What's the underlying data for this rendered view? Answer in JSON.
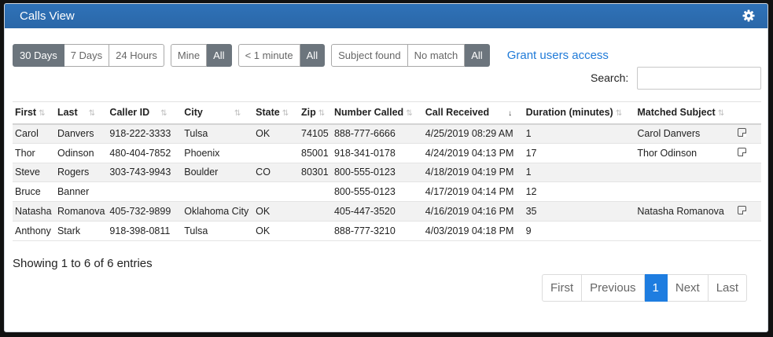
{
  "window": {
    "title": "Calls View"
  },
  "filters": {
    "time": [
      "30 Days",
      "7 Days",
      "24 Hours"
    ],
    "owner": [
      "Mine",
      "All"
    ],
    "duration": [
      "< 1 minute",
      "All"
    ],
    "match": [
      "Subject found",
      "No match",
      "All"
    ],
    "grant_link": "Grant users access"
  },
  "search": {
    "label": "Search:",
    "value": ""
  },
  "table": {
    "headers": [
      "First",
      "Last",
      "Caller ID",
      "City",
      "State",
      "Zip",
      "Number Called",
      "Call Received",
      "Duration (minutes)",
      "Matched Subject",
      ""
    ],
    "rows": [
      [
        "Carol",
        "Danvers",
        "918-222-3333",
        "Tulsa",
        "OK",
        "74105",
        "888-777-6666",
        "4/25/2019 08:29 AM",
        "1",
        "Carol Danvers"
      ],
      [
        "Thor",
        "Odinson",
        "480-404-7852",
        "Phoenix",
        "",
        "85001",
        "918-341-0178",
        "4/24/2019 04:13 PM",
        "17",
        "Thor Odinson"
      ],
      [
        "Steve",
        "Rogers",
        "303-743-9943",
        "Boulder",
        "CO",
        "80301",
        "800-555-0123",
        "4/18/2019 04:19 PM",
        "1",
        ""
      ],
      [
        "Bruce",
        "Banner",
        "",
        "",
        "",
        "",
        "800-555-0123",
        "4/17/2019 04:14 PM",
        "12",
        ""
      ],
      [
        "Natasha",
        "Romanova",
        "405-732-9899",
        "Oklahoma City",
        "OK",
        "",
        "405-447-3520",
        "4/16/2019 04:16 PM",
        "35",
        "Natasha Romanova"
      ],
      [
        "Anthony",
        "Stark",
        "918-398-0811",
        "Tulsa",
        "OK",
        "",
        "888-777-3210",
        "4/03/2019 04:18 PM",
        "9",
        ""
      ]
    ]
  },
  "info": "Showing 1 to 6 of 6 entries",
  "pager": {
    "first": "First",
    "previous": "Previous",
    "current": "1",
    "next": "Next",
    "last": "Last"
  }
}
